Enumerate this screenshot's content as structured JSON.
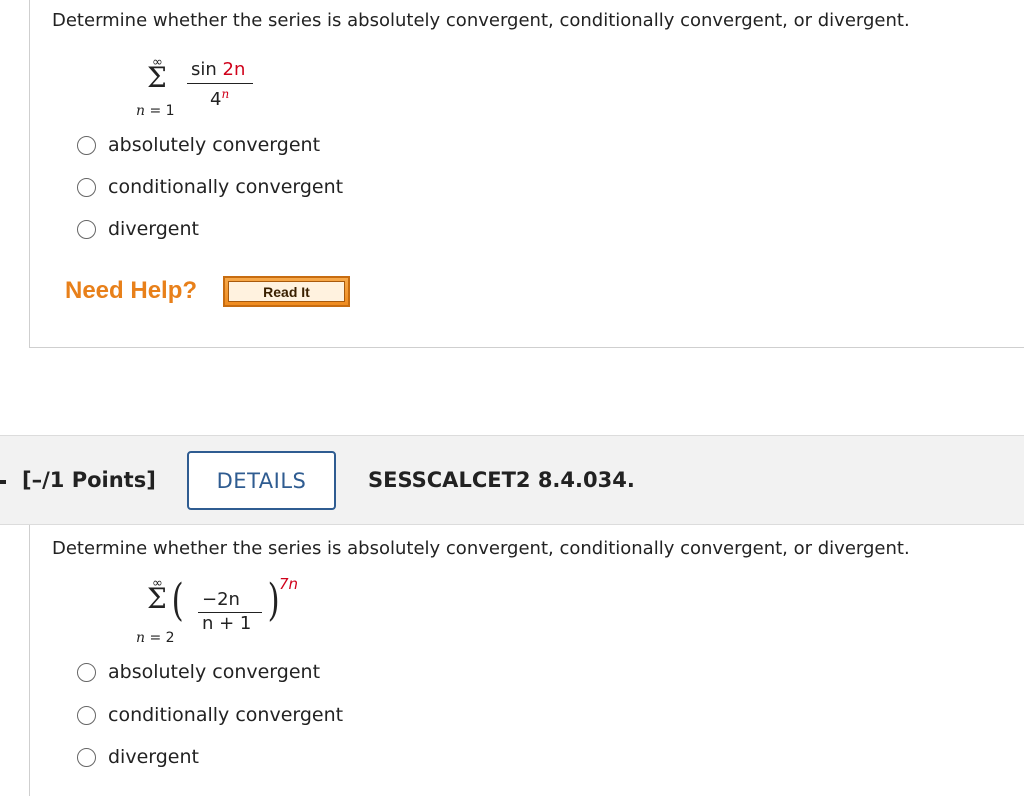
{
  "question1": {
    "prompt": "Determine whether the series is absolutely convergent, conditionally convergent, or divergent.",
    "series": {
      "upper": "∞",
      "sigma": "Σ",
      "lower_var": "n",
      "lower_eq": " = 1",
      "numerator_text": "sin ",
      "numerator_red": "2n",
      "denominator_base": "4",
      "denominator_exp": "n"
    },
    "options": [
      "absolutely convergent",
      "conditionally convergent",
      "divergent"
    ],
    "need_help_label": "Need Help?",
    "read_it_label": "Read It"
  },
  "question2": {
    "points_label": "[–/1 Points]",
    "details_label": "DETAILS",
    "code": "SESSCALCET2 8.4.034.",
    "prompt": "Determine whether the series is absolutely convergent, conditionally convergent, or divergent.",
    "series": {
      "upper": "∞",
      "sigma": "Σ",
      "lower_var": "n",
      "lower_eq": " = 2",
      "numerator": "−2n",
      "denominator": "n + 1",
      "exponent": "7n"
    },
    "options": [
      "absolutely convergent",
      "conditionally convergent",
      "divergent"
    ]
  },
  "colors": {
    "accent_red": "#d0021b",
    "details_blue": "#2f5c91",
    "need_help_orange": "#e8801a"
  }
}
